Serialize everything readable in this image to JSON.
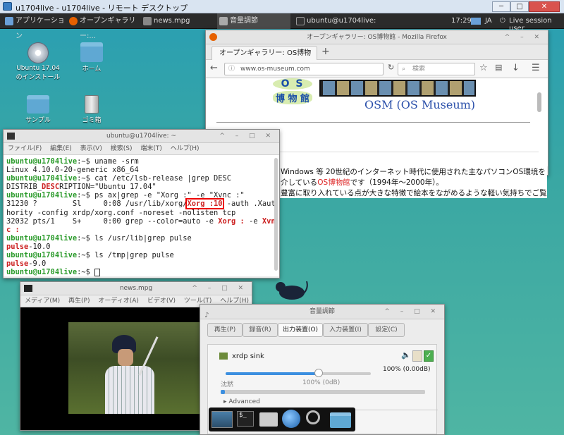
{
  "outer": {
    "title": "u1704live - u1704live - リモート デスクトップ"
  },
  "panel": {
    "apps_label": "アプリケーション",
    "tasks": [
      {
        "label": "オープンギャラリー:..."
      },
      {
        "label": "news.mpg"
      },
      {
        "label": "音量調節"
      },
      {
        "label": "ubuntu@u1704live: ~"
      }
    ],
    "clock": "17:29",
    "lang": "JA",
    "session": "Live session user"
  },
  "desktop_icons": [
    {
      "label": "Ubuntu 17.04\nのインストール",
      "icon": "disc-install-icon"
    },
    {
      "label": "ホーム",
      "icon": "home-folder-icon"
    },
    {
      "label": "サンプル",
      "icon": "folder-icon"
    },
    {
      "label": "ゴミ箱",
      "icon": "trash-icon"
    }
  ],
  "firefox": {
    "title": "オープンギャラリー: OS博物館 - Mozilla Firefox",
    "tab_label": "オープンギャラリー: OS博物館",
    "url": "www.os-museum.com",
    "search_placeholder": "検索",
    "logo_letters": "O S",
    "logo_kanji": "博 物 館",
    "site_title": "OSM (OS Museum)",
    "text_line1": "Windows 等 20世紀のインターネット時代に使用された主なパソコンOS環境を",
    "text_line2_a": "介している",
    "text_line2_link": "OS博物館",
    "text_line2_b": "です（1994年〜2000年）。",
    "text_line3": "豊富に取り入れている点が大きな特徴で絵本をながめるような軽い気持ちでご覧"
  },
  "terminal": {
    "title": "ubuntu@u1704live: ~",
    "menu": [
      "ファイル(F)",
      "編集(E)",
      "表示(V)",
      "検索(S)",
      "端末(T)",
      "ヘルプ(H)"
    ],
    "prompt": "ubuntu@u1704live",
    "l1_cmd": ":~$ uname -srm",
    "l2": "Linux 4.10.0-20-generic x86_64",
    "l3_cmd": ":~$ cat /etc/lsb-release |grep DESC",
    "l4_a": "DISTRIB_",
    "l4_b": "DESC",
    "l4_c": "RIPTION=\"Ubuntu 17.04\"",
    "l5_cmd": ":~$ ps ax|grep -e \"Xorg :\" -e \"Xvnc :\"",
    "l6_a": "31230 ?        Sl     0:08 /usr/lib/xorg/",
    "l6_b": "Xorg :10",
    "l6_c": " -auth .Xaut",
    "l7": "hority -config xrdp/xorg.conf -noreset -nolisten tcp",
    "l8_a": "32032 pts/1    S+     0:00 grep --color=auto -e ",
    "l8_b": "Xorg :",
    "l8_c": " -e ",
    "l8_d": "Xvn",
    "l9": "c :",
    "l10_cmd": ":~$ ls /usr/lib|grep pulse",
    "l11_a": "pulse",
    "l11_b": "-10.0",
    "l12_cmd": ":~$ ls /tmp|grep pulse",
    "l13_a": "pulse",
    "l13_b": "-9.0",
    "l14_cmd": ":~$ "
  },
  "video": {
    "title": "news.mpg",
    "menu": [
      "メディア(M)",
      "再生(P)",
      "オーディオ(A)",
      "ビデオ(V)",
      "ツール(T)",
      "ヘルプ(H)"
    ]
  },
  "sound": {
    "title": "音量調節",
    "tabs": [
      "再生(P)",
      "録音(R)",
      "出力装置(O)",
      "入力装置(I)",
      "設定(C)"
    ],
    "selected_tab": 2,
    "device": "xrdp sink",
    "mute_label": "沈黙",
    "level_label": "100% (0dB)",
    "value_label": "100% (0.00dB)",
    "slider_value": 1.0,
    "peak_value": 0.02,
    "advanced": "Advanced"
  },
  "colors": {
    "accent": "#3c8fe0",
    "terminal_green": "#2a9a2a",
    "terminal_red": "#cc2222"
  }
}
